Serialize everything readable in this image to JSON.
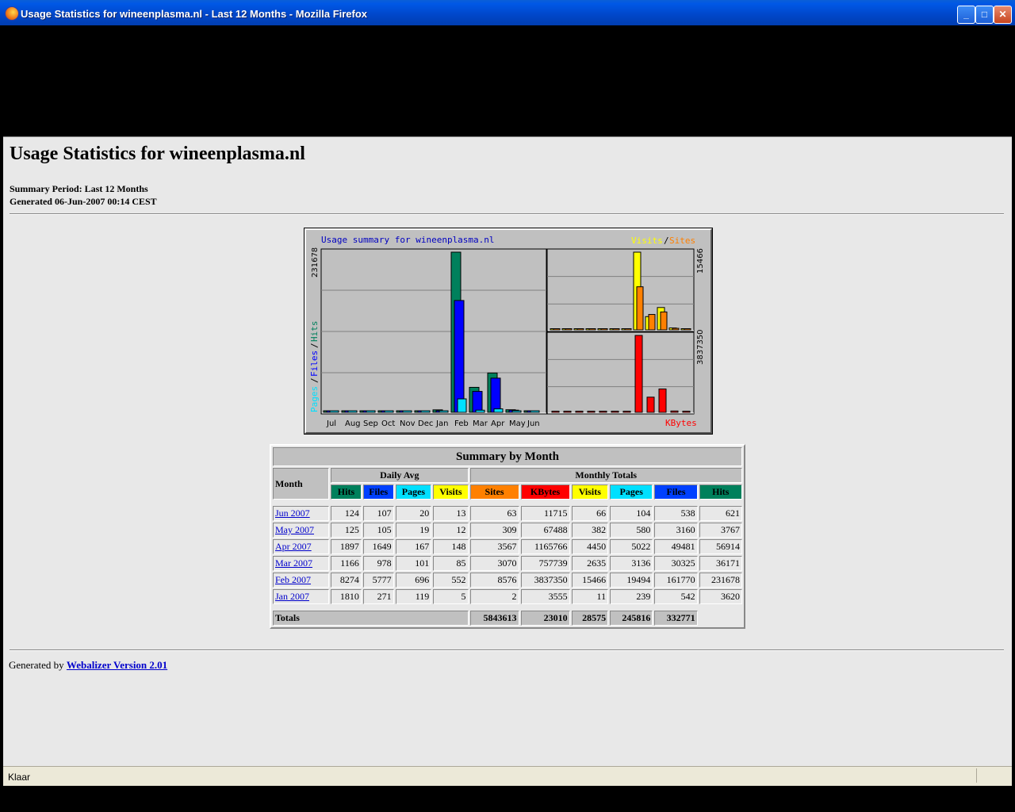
{
  "window": {
    "title": "Usage Statistics for wineenplasma.nl - Last 12 Months - Mozilla Firefox"
  },
  "page": {
    "title": "Usage Statistics for wineenplasma.nl",
    "summary_period": "Summary Period: Last 12 Months",
    "generated": "Generated 06-Jun-2007 00:14 CEST"
  },
  "graph": {
    "title": "Usage summary for wineenplasma.nl",
    "legend_visits": "Visits",
    "legend_slash": "/",
    "legend_sites": "Sites",
    "legend_pages": "Pages",
    "legend_files": "Files",
    "legend_hits": "Hits",
    "legend_kbytes": "KBytes",
    "left_max": "231678",
    "right_top_max": "15466",
    "right_bottom_max": "3837350",
    "months": [
      "Jul",
      "Aug",
      "Sep",
      "Oct",
      "Nov",
      "Dec",
      "Jan",
      "Feb",
      "Mar",
      "Apr",
      "May",
      "Jun"
    ],
    "colors": {
      "hits": "#00805c",
      "files": "#0000ff",
      "pages": "#00e0ff",
      "visits": "#ffff00",
      "sites": "#ff8000",
      "kbytes": "#ff0000"
    }
  },
  "chart_data": {
    "type": "bar",
    "title": "Usage summary for wineenplasma.nl",
    "categories": [
      "Jul",
      "Aug",
      "Sep",
      "Oct",
      "Nov",
      "Dec",
      "Jan",
      "Feb",
      "Mar",
      "Apr",
      "May",
      "Jun"
    ],
    "series": [
      {
        "name": "Hits",
        "values": [
          0,
          0,
          0,
          0,
          0,
          0,
          3620,
          231678,
          36171,
          56914,
          3767,
          621
        ]
      },
      {
        "name": "Files",
        "values": [
          0,
          0,
          0,
          0,
          0,
          0,
          542,
          161770,
          30325,
          49481,
          3160,
          538
        ]
      },
      {
        "name": "Pages",
        "values": [
          0,
          0,
          0,
          0,
          0,
          0,
          239,
          19494,
          3136,
          5022,
          580,
          104
        ]
      },
      {
        "name": "Visits",
        "values": [
          0,
          0,
          0,
          0,
          0,
          0,
          11,
          15466,
          2635,
          4450,
          382,
          66
        ]
      },
      {
        "name": "Sites",
        "values": [
          0,
          0,
          0,
          0,
          0,
          0,
          2,
          8576,
          3070,
          3567,
          309,
          63
        ]
      },
      {
        "name": "KBytes",
        "values": [
          0,
          0,
          0,
          0,
          0,
          0,
          3555,
          3837350,
          757739,
          1165766,
          67488,
          11715
        ]
      }
    ]
  },
  "table": {
    "caption": "Summary by Month",
    "month_header": "Month",
    "daily_avg_header": "Daily Avg",
    "monthly_totals_header": "Monthly Totals",
    "daily_cols": [
      "Hits",
      "Files",
      "Pages",
      "Visits"
    ],
    "monthly_cols": [
      "Sites",
      "KBytes",
      "Visits",
      "Pages",
      "Files",
      "Hits"
    ],
    "rows": [
      {
        "month": "Jun 2007",
        "d_hits": "124",
        "d_files": "107",
        "d_pages": "20",
        "d_visits": "13",
        "sites": "63",
        "kbytes": "11715",
        "visits": "66",
        "pages": "104",
        "files": "538",
        "hits": "621"
      },
      {
        "month": "May 2007",
        "d_hits": "125",
        "d_files": "105",
        "d_pages": "19",
        "d_visits": "12",
        "sites": "309",
        "kbytes": "67488",
        "visits": "382",
        "pages": "580",
        "files": "3160",
        "hits": "3767"
      },
      {
        "month": "Apr 2007",
        "d_hits": "1897",
        "d_files": "1649",
        "d_pages": "167",
        "d_visits": "148",
        "sites": "3567",
        "kbytes": "1165766",
        "visits": "4450",
        "pages": "5022",
        "files": "49481",
        "hits": "56914"
      },
      {
        "month": "Mar 2007",
        "d_hits": "1166",
        "d_files": "978",
        "d_pages": "101",
        "d_visits": "85",
        "sites": "3070",
        "kbytes": "757739",
        "visits": "2635",
        "pages": "3136",
        "files": "30325",
        "hits": "36171"
      },
      {
        "month": "Feb 2007",
        "d_hits": "8274",
        "d_files": "5777",
        "d_pages": "696",
        "d_visits": "552",
        "sites": "8576",
        "kbytes": "3837350",
        "visits": "15466",
        "pages": "19494",
        "files": "161770",
        "hits": "231678"
      },
      {
        "month": "Jan 2007",
        "d_hits": "1810",
        "d_files": "271",
        "d_pages": "119",
        "d_visits": "5",
        "sites": "2",
        "kbytes": "3555",
        "visits": "11",
        "pages": "239",
        "files": "542",
        "hits": "3620"
      }
    ],
    "totals": {
      "label": "Totals",
      "kbytes": "5843613",
      "visits": "23010",
      "pages": "28575",
      "files": "245816",
      "hits": "332771"
    }
  },
  "footer": {
    "prefix": "Generated by ",
    "link": "Webalizer Version 2.01"
  },
  "statusbar": {
    "text": "Klaar"
  }
}
